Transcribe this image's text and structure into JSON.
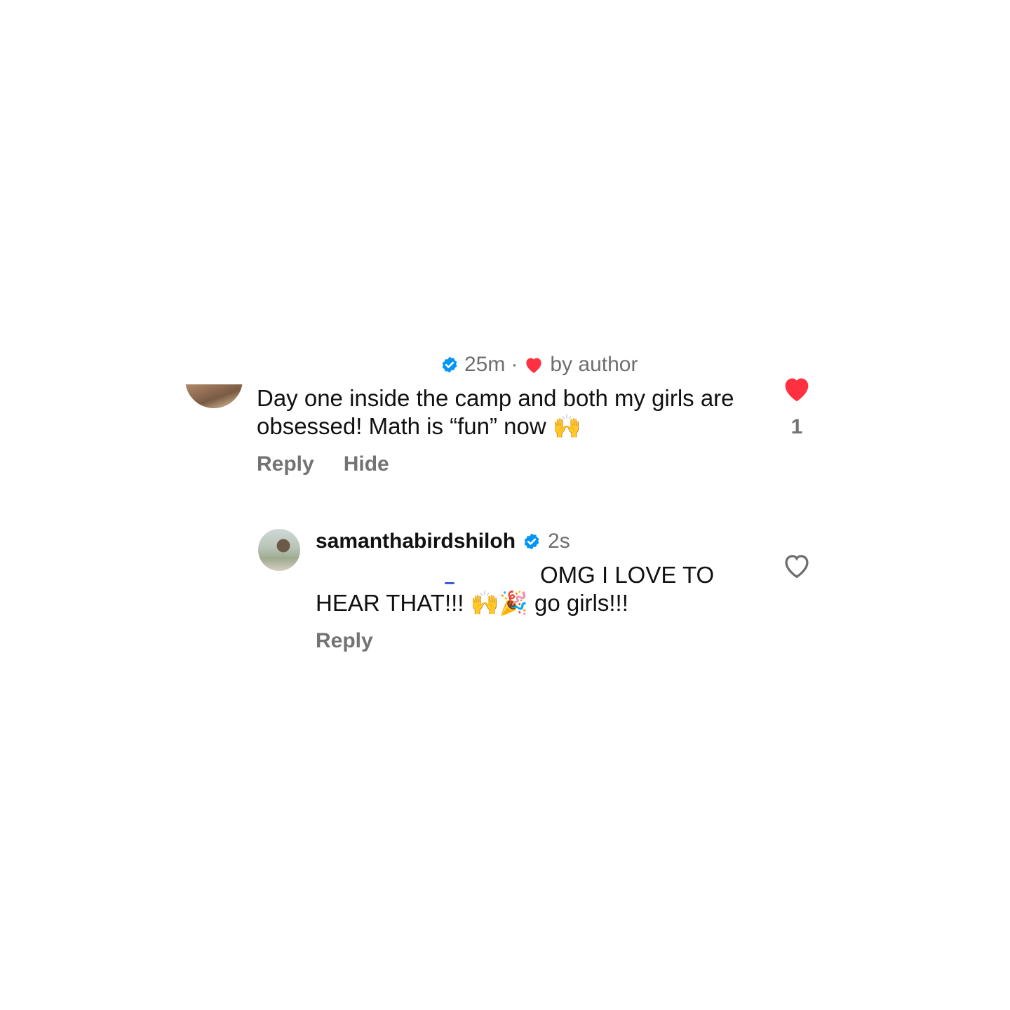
{
  "comment1": {
    "time": "25m",
    "separator": "·",
    "liked_by_author": "by author",
    "text": "Day one inside the camp and both my girls are obsessed! Math is “fun” now 🙌",
    "actions": {
      "reply": "Reply",
      "hide": "Hide"
    },
    "like_count": "1",
    "colors": {
      "heart": "#ff3040",
      "verified": "#0095f6",
      "muted": "#737373"
    }
  },
  "comment2": {
    "username": "samanthabirdshiloh",
    "time": "2s",
    "text_line1": "OMG I LOVE TO",
    "text_line2": "HEAR THAT!!! 🙌🎉 go girls!!!",
    "actions": {
      "reply": "Reply"
    },
    "icons": [
      "verified-badge-icon",
      "heart-outline-icon"
    ]
  }
}
